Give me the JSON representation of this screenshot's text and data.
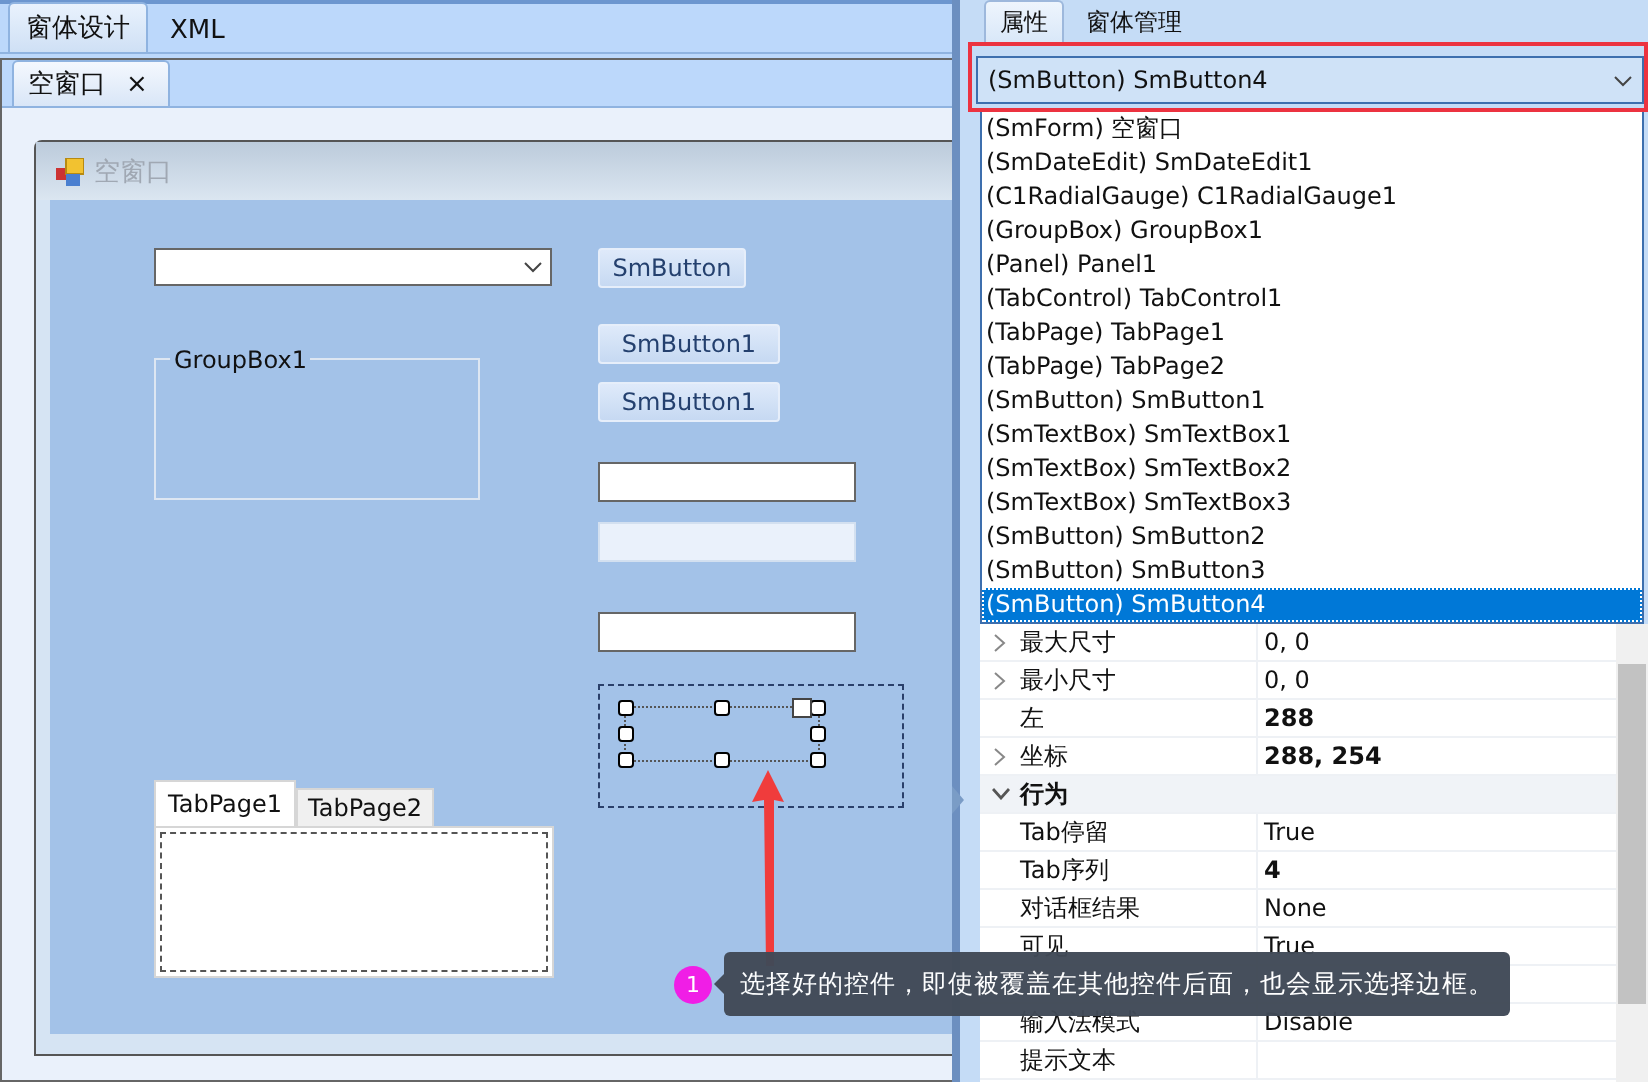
{
  "main_tabs": [
    {
      "label": "窗体设计",
      "selected": true
    },
    {
      "label": "XML",
      "selected": false
    }
  ],
  "document_tabs": [
    {
      "label": "空窗口",
      "close": "×",
      "selected": true
    }
  ],
  "form": {
    "title": "空窗口",
    "controls": [
      {
        "kind": "combobox"
      },
      {
        "kind": "button",
        "label": "SmButton"
      },
      {
        "kind": "button",
        "label": "SmButton1"
      },
      {
        "kind": "button",
        "label": "SmButton1"
      },
      {
        "kind": "groupbox",
        "label": "GroupBox1"
      },
      {
        "kind": "textbox",
        "disabled": false
      },
      {
        "kind": "textbox",
        "disabled": true
      },
      {
        "kind": "textbox",
        "disabled": false
      },
      {
        "kind": "panel",
        "selected": true
      },
      {
        "kind": "tabcontrol",
        "tabs": [
          {
            "label": "TabPage1",
            "selected": true
          },
          {
            "label": "TabPage2",
            "selected": false
          }
        ]
      }
    ]
  },
  "callout": {
    "badge": "1",
    "text": "选择好的控件，即使被覆盖在其他控件后面，也会显示选择边框。"
  },
  "side_tabs": [
    {
      "label": "属性",
      "selected": true
    },
    {
      "label": "窗体管理",
      "selected": false
    }
  ],
  "object_selector": {
    "value": "(SmButton) SmButton4",
    "options": [
      {
        "label": "(SmForm) 空窗口",
        "selected": false
      },
      {
        "label": "(SmDateEdit) SmDateEdit1",
        "selected": false
      },
      {
        "label": "(C1RadialGauge) C1RadialGauge1",
        "selected": false
      },
      {
        "label": "(GroupBox) GroupBox1",
        "selected": false
      },
      {
        "label": "(Panel) Panel1",
        "selected": false
      },
      {
        "label": "(TabControl) TabControl1",
        "selected": false
      },
      {
        "label": "(TabPage) TabPage1",
        "selected": false
      },
      {
        "label": "(TabPage) TabPage2",
        "selected": false
      },
      {
        "label": "(SmButton) SmButton1",
        "selected": false
      },
      {
        "label": "(SmTextBox) SmTextBox1",
        "selected": false
      },
      {
        "label": "(SmTextBox) SmTextBox2",
        "selected": false
      },
      {
        "label": "(SmTextBox) SmTextBox3",
        "selected": false
      },
      {
        "label": "(SmButton) SmButton2",
        "selected": false
      },
      {
        "label": "(SmButton) SmButton3",
        "selected": false
      },
      {
        "label": "(SmButton) SmButton4",
        "selected": true
      }
    ]
  },
  "properties": [
    {
      "kind": "group",
      "name": "最大尺寸",
      "value": "0, 0",
      "modified": false,
      "expanded": false
    },
    {
      "kind": "group",
      "name": "最小尺寸",
      "value": "0, 0",
      "modified": false,
      "expanded": false
    },
    {
      "kind": "property",
      "name": "左",
      "value": "288",
      "modified": true
    },
    {
      "kind": "group",
      "name": "坐标",
      "value": "288, 254",
      "modified": true,
      "expanded": false
    },
    {
      "kind": "category",
      "name": "行为",
      "expanded": true,
      "children": [
        {
          "kind": "property",
          "name": "Tab停留",
          "value": "True",
          "modified": false
        },
        {
          "kind": "property",
          "name": "Tab序列",
          "value": "4",
          "modified": true
        },
        {
          "kind": "property",
          "name": "对话框结果",
          "value": "None",
          "modified": false
        },
        {
          "kind": "property",
          "name": "可见",
          "value": "True",
          "modified": false
        },
        {
          "kind": "property"
        },
        {
          "kind": "property",
          "name": "输入法模式",
          "value": "Disable",
          "modified": false
        },
        {
          "kind": "property",
          "name": "提示文本"
        }
      ]
    }
  ]
}
